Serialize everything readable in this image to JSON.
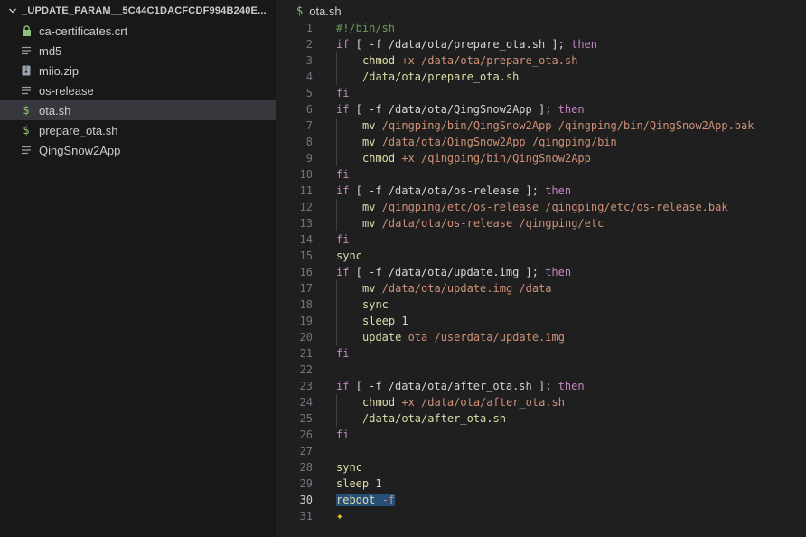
{
  "explorer": {
    "folder_name": "_UPDATE_PARAM__5C44C1DACFCDF994B240E...",
    "files": [
      {
        "name": "ca-certificates.crt",
        "icon": "lock-icon"
      },
      {
        "name": "md5",
        "icon": "lines-icon"
      },
      {
        "name": "miio.zip",
        "icon": "zip-icon"
      },
      {
        "name": "os-release",
        "icon": "lines-icon"
      },
      {
        "name": "ota.sh",
        "icon": "dollar-icon",
        "active": true
      },
      {
        "name": "prepare_ota.sh",
        "icon": "dollar-icon"
      },
      {
        "name": "QingSnow2App",
        "icon": "lines-icon"
      }
    ]
  },
  "tab": {
    "title": "ota.sh",
    "icon_glyph": "$"
  },
  "editor": {
    "current_line": 30,
    "lines": [
      {
        "n": 1,
        "indent": 0,
        "tokens": [
          [
            "cm",
            "#!/bin/sh"
          ]
        ]
      },
      {
        "n": 2,
        "indent": 0,
        "tokens": [
          [
            "kw",
            "if"
          ],
          [
            "plain",
            " [ -f /data/ota/prepare_ota.sh ]; "
          ],
          [
            "kw",
            "then"
          ]
        ]
      },
      {
        "n": 3,
        "indent": 1,
        "tokens": [
          [
            "cmd",
            "chmod"
          ],
          [
            "str",
            " +x /data/ota/prepare_ota.sh"
          ]
        ]
      },
      {
        "n": 4,
        "indent": 1,
        "tokens": [
          [
            "cmd",
            "/data/ota/prepare_ota.sh"
          ]
        ]
      },
      {
        "n": 5,
        "indent": 0,
        "tokens": [
          [
            "kw",
            "fi"
          ]
        ]
      },
      {
        "n": 6,
        "indent": 0,
        "tokens": [
          [
            "kw",
            "if"
          ],
          [
            "plain",
            " [ -f /data/ota/QingSnow2App ]; "
          ],
          [
            "kw",
            "then"
          ]
        ]
      },
      {
        "n": 7,
        "indent": 1,
        "tokens": [
          [
            "cmd",
            "mv"
          ],
          [
            "str",
            " /qingping/bin/QingSnow2App /qingping/bin/QingSnow2App.bak"
          ]
        ]
      },
      {
        "n": 8,
        "indent": 1,
        "tokens": [
          [
            "cmd",
            "mv"
          ],
          [
            "str",
            " /data/ota/QingSnow2App /qingping/bin"
          ]
        ]
      },
      {
        "n": 9,
        "indent": 1,
        "tokens": [
          [
            "cmd",
            "chmod"
          ],
          [
            "str",
            " +x /qingping/bin/QingSnow2App"
          ]
        ]
      },
      {
        "n": 10,
        "indent": 0,
        "tokens": [
          [
            "kw",
            "fi"
          ]
        ]
      },
      {
        "n": 11,
        "indent": 0,
        "tokens": [
          [
            "kw",
            "if"
          ],
          [
            "plain",
            " [ -f /data/ota/os-release ]; "
          ],
          [
            "kw",
            "then"
          ]
        ]
      },
      {
        "n": 12,
        "indent": 1,
        "tokens": [
          [
            "cmd",
            "mv"
          ],
          [
            "str",
            " /qingping/etc/os-release /qingping/etc/os-release.bak"
          ]
        ]
      },
      {
        "n": 13,
        "indent": 1,
        "tokens": [
          [
            "cmd",
            "mv"
          ],
          [
            "str",
            " /data/ota/os-release /qingping/etc"
          ]
        ]
      },
      {
        "n": 14,
        "indent": 0,
        "tokens": [
          [
            "kw",
            "fi"
          ]
        ]
      },
      {
        "n": 15,
        "indent": 0,
        "tokens": [
          [
            "cmd",
            "sync"
          ]
        ]
      },
      {
        "n": 16,
        "indent": 0,
        "tokens": [
          [
            "kw",
            "if"
          ],
          [
            "plain",
            " [ -f /data/ota/update.img ]; "
          ],
          [
            "kw",
            "then"
          ]
        ]
      },
      {
        "n": 17,
        "indent": 1,
        "tokens": [
          [
            "cmd",
            "mv"
          ],
          [
            "str",
            " /data/ota/update.img /data"
          ]
        ]
      },
      {
        "n": 18,
        "indent": 1,
        "tokens": [
          [
            "cmd",
            "sync"
          ]
        ]
      },
      {
        "n": 19,
        "indent": 1,
        "tokens": [
          [
            "cmd",
            "sleep"
          ],
          [
            "plain",
            " 1"
          ]
        ]
      },
      {
        "n": 20,
        "indent": 1,
        "tokens": [
          [
            "cmd",
            "update"
          ],
          [
            "str",
            " ota /userdata/update.img"
          ]
        ]
      },
      {
        "n": 21,
        "indent": 0,
        "tokens": [
          [
            "kw",
            "fi"
          ]
        ]
      },
      {
        "n": 22,
        "indent": 0,
        "tokens": []
      },
      {
        "n": 23,
        "indent": 0,
        "tokens": [
          [
            "kw",
            "if"
          ],
          [
            "plain",
            " [ -f /data/ota/after_ota.sh ]; "
          ],
          [
            "kw",
            "then"
          ]
        ]
      },
      {
        "n": 24,
        "indent": 1,
        "tokens": [
          [
            "cmd",
            "chmod"
          ],
          [
            "str",
            " +x /data/ota/after_ota.sh"
          ]
        ]
      },
      {
        "n": 25,
        "indent": 1,
        "tokens": [
          [
            "cmd",
            "/data/ota/after_ota.sh"
          ]
        ]
      },
      {
        "n": 26,
        "indent": 0,
        "tokens": [
          [
            "kw",
            "fi"
          ]
        ]
      },
      {
        "n": 27,
        "indent": 0,
        "tokens": []
      },
      {
        "n": 28,
        "indent": 0,
        "tokens": [
          [
            "cmd",
            "sync"
          ]
        ]
      },
      {
        "n": 29,
        "indent": 0,
        "tokens": [
          [
            "cmd",
            "sleep"
          ],
          [
            "plain",
            " 1"
          ]
        ]
      },
      {
        "n": 30,
        "indent": 0,
        "selected": true,
        "tokens": [
          [
            "cmd",
            "reboot"
          ],
          [
            "str",
            " -f"
          ]
        ]
      },
      {
        "n": 31,
        "indent": 0,
        "sparkle": true,
        "tokens": []
      }
    ]
  },
  "colors": {
    "keyword": "#c586c0",
    "command": "#dcdcaa",
    "string": "#ce9178",
    "comment": "#6a9955",
    "selection": "#264f78",
    "active_file_bg": "#37373d"
  }
}
